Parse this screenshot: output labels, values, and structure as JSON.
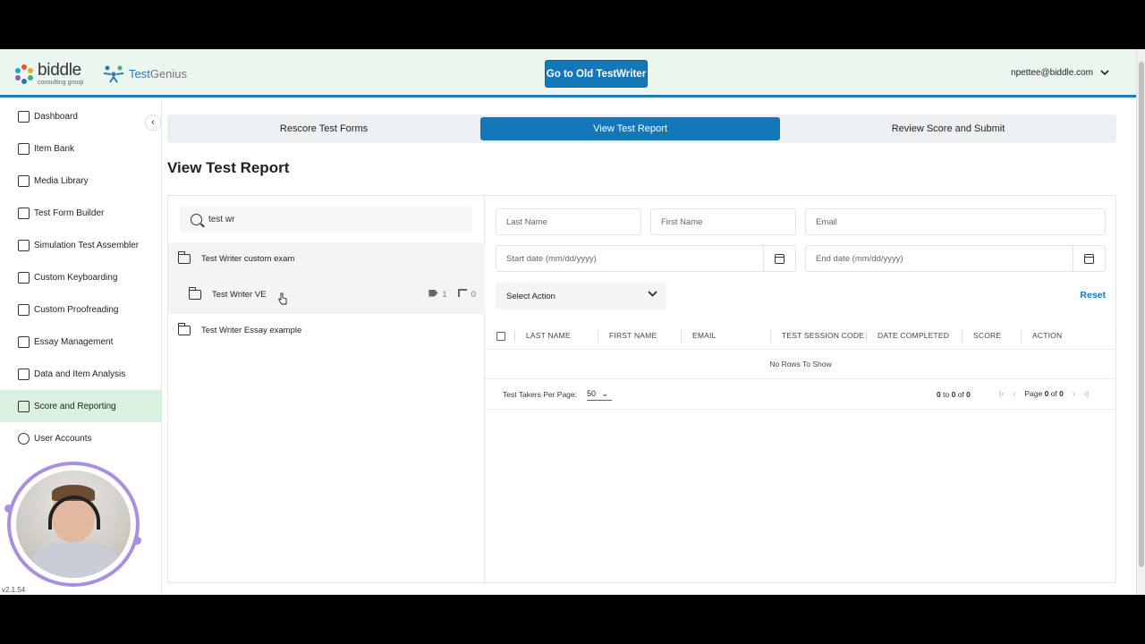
{
  "header": {
    "brand_name": "biddle",
    "brand_tagline": "consulting group",
    "product_name_1": "Test",
    "product_name_2": "Genius",
    "old_button_label": "Go to Old TestWriter",
    "user_email": "npettee@biddle.com",
    "accent_color": "#1478b8"
  },
  "sidebar": {
    "items": [
      {
        "label": "Dashboard",
        "icon": "grid-icon"
      },
      {
        "label": "Item Bank",
        "icon": "bookmark-icon"
      },
      {
        "label": "Media Library",
        "icon": "image-icon"
      },
      {
        "label": "Test Form Builder",
        "icon": "list-icon"
      },
      {
        "label": "Simulation Test Assembler",
        "icon": "list-icon"
      },
      {
        "label": "Custom Keyboarding",
        "icon": "keyboard-icon"
      },
      {
        "label": "Custom Proofreading",
        "icon": "p-icon"
      },
      {
        "label": "Essay Management",
        "icon": "list-icon"
      },
      {
        "label": "Data and Item Analysis",
        "icon": "chart-icon"
      },
      {
        "label": "Score and Reporting",
        "icon": "report-icon"
      },
      {
        "label": "User Accounts",
        "icon": "user-icon"
      }
    ],
    "active_index": 9,
    "version": "v2.1.54"
  },
  "tabs": [
    {
      "label": "Rescore Test Forms"
    },
    {
      "label": "View Test Report"
    },
    {
      "label": "Review Score and Submit"
    }
  ],
  "page_title": "View Test Report",
  "left_pane": {
    "search_value": "test wr",
    "tree": [
      {
        "label": "Test Writer custom exam"
      },
      {
        "label": "Test Writer VE",
        "tags": "1",
        "links": "0"
      },
      {
        "label": "Test Writer Essay example"
      }
    ]
  },
  "filters": {
    "last_name": "Last Name",
    "first_name": "First Name",
    "email": "Email",
    "start_date": "Start date (mm/dd/yyyy)",
    "end_date": "End date (mm/dd/yyyy)",
    "select_action": "Select Action",
    "reset": "Reset"
  },
  "grid": {
    "columns": [
      "LAST NAME",
      "FIRST NAME",
      "EMAIL",
      "TEST SESSION CODE",
      "DATE COMPLETED",
      "SCORE",
      "ACTION"
    ],
    "empty_message": "No Rows To Show",
    "per_page_label": "Test Takers Per Page:",
    "per_page_value": "50",
    "range_from": "0",
    "range_to_word": "to",
    "range_to": "0",
    "range_of_word": "of",
    "range_total": "0",
    "page_word": "Page",
    "page_current": "0",
    "page_of_word": "of",
    "page_total": "0"
  }
}
